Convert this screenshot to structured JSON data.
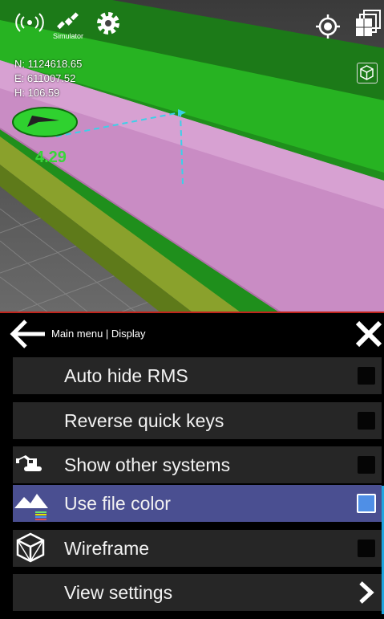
{
  "status_bar": {
    "icons": [
      "broadcast-icon",
      "satellite-icon",
      "gear-icon",
      "locate-icon",
      "layers-icon",
      "view-cube-icon"
    ],
    "simulator_label": "Simulator"
  },
  "coordinates": {
    "north": "N: 1124618.65",
    "east": "E: 611007.52",
    "height": "H: 106.59"
  },
  "position_value": "4.29",
  "colors": {
    "selected_row": "#4a4f91",
    "row": "#262626",
    "checked": "#4f8fe6",
    "surface_pink": "#c98cc4",
    "surface_green": "#24a11f",
    "red_divider": "#c0241c"
  },
  "menu": {
    "breadcrumb": "Main menu | Display",
    "items": [
      {
        "label": "Auto hide RMS",
        "icon": "",
        "control": "checkbox",
        "checked": false,
        "selected": false
      },
      {
        "label": "Reverse quick keys",
        "icon": "",
        "control": "checkbox",
        "checked": false,
        "selected": false
      },
      {
        "label": "Show other systems",
        "icon": "excavator-icon",
        "control": "checkbox",
        "checked": false,
        "selected": false
      },
      {
        "label": "Use file color",
        "icon": "terrain-icon",
        "control": "checkbox",
        "checked": true,
        "selected": true
      },
      {
        "label": "Wireframe",
        "icon": "wireframe-cube-icon",
        "control": "checkbox",
        "checked": false,
        "selected": false
      },
      {
        "label": "View settings",
        "icon": "",
        "control": "chevron",
        "checked": false,
        "selected": false
      }
    ]
  }
}
